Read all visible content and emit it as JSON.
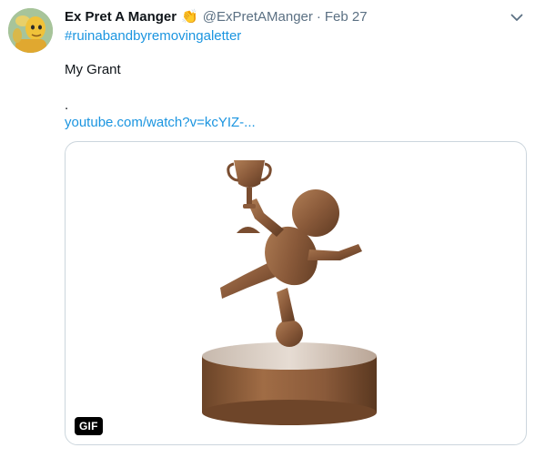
{
  "tweet": {
    "display_name": "Ex Pret A Manger",
    "name_emoji": "👏",
    "handle": "@ExPretAManger",
    "separator": "·",
    "timestamp": "Feb 27",
    "hashtag": "#ruinabandbyremovingaletter",
    "text_line_1": "My Grant",
    "text_line_2": ".",
    "link": "youtube.com/watch?v=kcYIZ-...",
    "media": {
      "badge": "GIF",
      "icon": "bronze-trophy-figure"
    }
  },
  "colors": {
    "link": "#1b95e0",
    "secondary_text": "#5b7083",
    "primary_text": "#0f1419",
    "media_border": "#ccd6dd",
    "bronze": "#8a5a3a"
  }
}
